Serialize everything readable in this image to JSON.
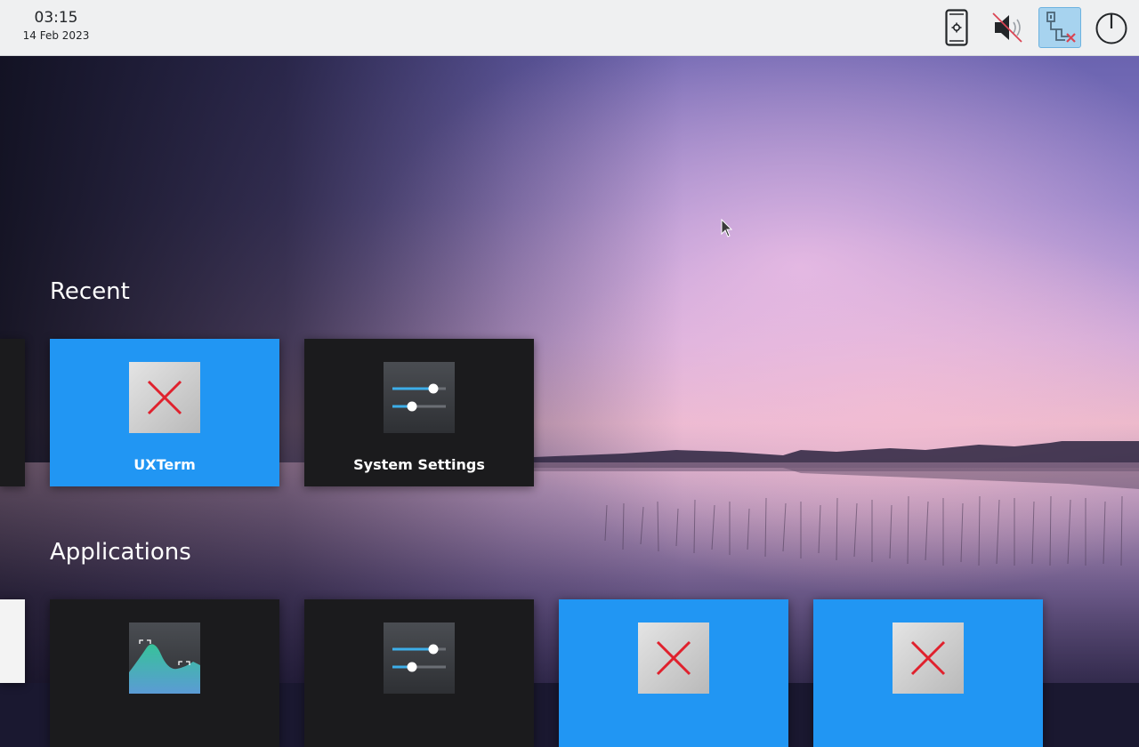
{
  "panel": {
    "time": "03:15",
    "date": "14 Feb 2023",
    "tray_icons": [
      "phone-settings-icon",
      "volume-muted-icon",
      "network-disconnected-icon",
      "power-icon"
    ]
  },
  "recent": {
    "title": "Recent",
    "tiles": [
      {
        "label": "UXTerm",
        "icon": "broken-image-icon",
        "style": "blue"
      },
      {
        "label": "System Settings",
        "icon": "settings-sliders-icon",
        "style": "dark"
      }
    ]
  },
  "applications": {
    "title": "Applications",
    "tiles": [
      {
        "label": "",
        "icon": "system-monitor-icon",
        "style": "dark"
      },
      {
        "label": "",
        "icon": "settings-sliders-icon",
        "style": "dark"
      },
      {
        "label": "",
        "icon": "broken-image-icon",
        "style": "blue"
      },
      {
        "label": "",
        "icon": "broken-image-icon",
        "style": "blue"
      }
    ]
  },
  "colors": {
    "accent": "#2196f3",
    "tile_dark": "#1b1b1d",
    "panel_bg": "#eff0f1"
  }
}
